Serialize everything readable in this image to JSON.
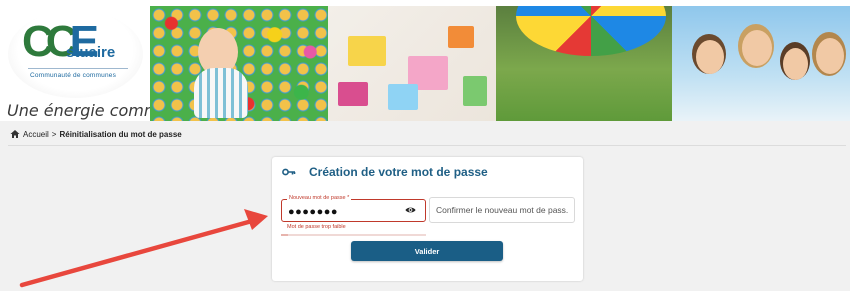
{
  "header": {
    "logo": {
      "brand": "CCEstuaire",
      "brand_word": "stuaire",
      "subtitle": "Communauté de communes"
    },
    "tagline": "Une énergie commune"
  },
  "breadcrumb": {
    "home_icon": "home-icon",
    "home_label": "Accueil",
    "separator": ">",
    "current": "Réinitialisation du mot de passe"
  },
  "form": {
    "title_icon": "key-icon",
    "title": "Création de votre mot de passe",
    "new_password": {
      "label": "Nouveau mot de passe *",
      "value": "●●●●●●●",
      "toggle_icon": "eye-icon",
      "error": "Mot de passe trop faible",
      "strength": 0.05
    },
    "confirm_password": {
      "placeholder": "Confirmer le nouveau mot de pass..."
    },
    "submit_label": "Valider"
  },
  "colors": {
    "accent": "#1a5e86",
    "title": "#1f5f85",
    "error": "#c0392b",
    "annotation_arrow": "#e8473d"
  }
}
